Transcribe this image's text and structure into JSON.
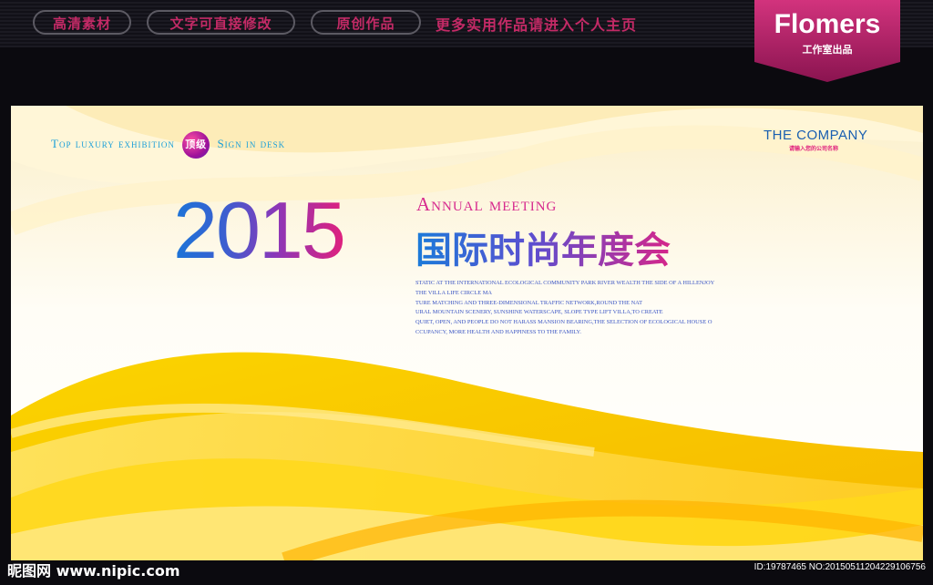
{
  "topbar": {
    "buttons": [
      "高清素材",
      "文字可直接修改",
      "原创作品"
    ],
    "promo": "更多实用作品请进入个人主页",
    "brand_name": "Flomers",
    "brand_sub": "工作室出品"
  },
  "poster": {
    "tagline_a": "Top luxury exhibition",
    "badge": "顶级",
    "tagline_b": "Sign in desk",
    "company": "THE COMPANY",
    "company_sub": "请输入您的公司名称",
    "year": "2015",
    "annual": "Annual meeting",
    "cn_title": "国际时尚年度会",
    "body_lines": [
      "STATIC AT THE INTERNATIONAL ECOLOGICAL COMMUNITY PARK RIVER WEALTH THE SIDE OF A HILLENJOY",
      "THE VILLA LIFE CIRCLE MA",
      "TURE MATCHING AND THREE-DIMENSIONAL TRAFFIC NETWORK,ROUND THE NAT",
      "URAL MOUNTAIN SCENERY, SUNSHINE WATERSCAPE, SLOPE TYPE LIFT VILLA,TO CREATE",
      "QUIET, OPEN, AND PEOPLE DO NOT HARASS MANSION BEARING,THE SELECTION OF ECOLOGICAL HOUSE O",
      "CCUPANCY, MORE HEALTH AND HAPPINESS TO THE FAMILY."
    ]
  },
  "footer": {
    "watermark": "昵图网 www.nipic.com",
    "id_text": "ID:19787465 NO:20150511204229106756"
  },
  "colors": {
    "accent_pink": "#c32a66",
    "yellow": "#f8c400",
    "blue": "#1b75d8"
  }
}
